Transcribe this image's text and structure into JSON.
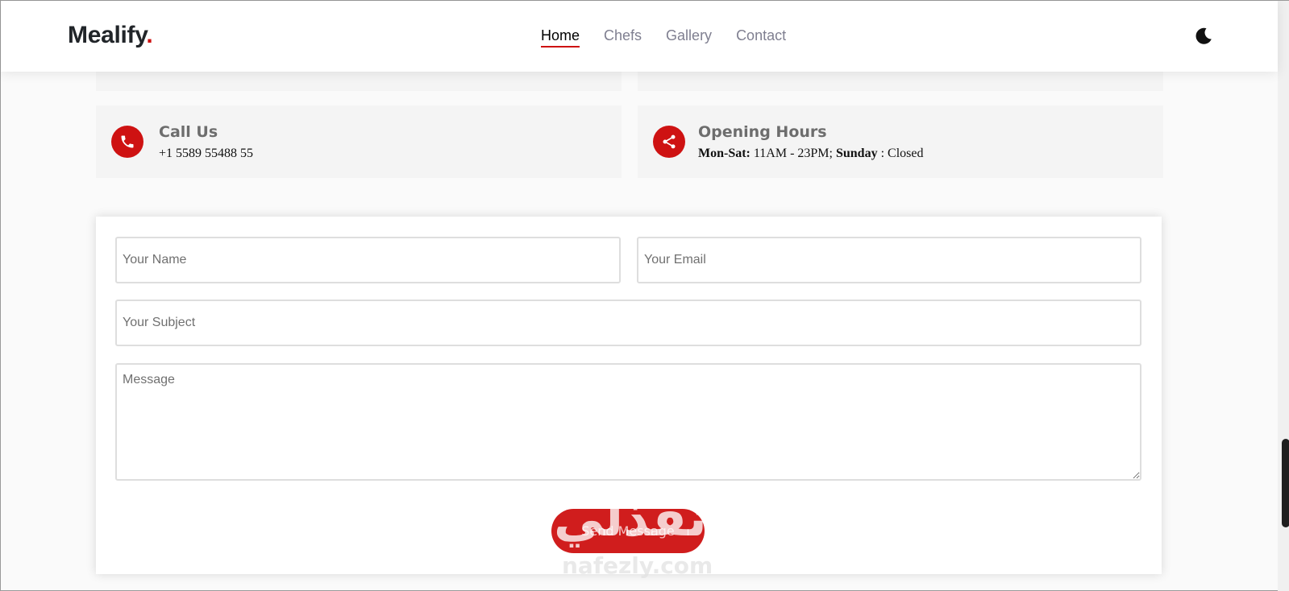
{
  "header": {
    "logo_text": "Mealify",
    "logo_dot": ".",
    "nav": [
      {
        "label": "Home",
        "active": true
      },
      {
        "label": "Chefs",
        "active": false
      },
      {
        "label": "Gallery",
        "active": false
      },
      {
        "label": "Contact",
        "active": false
      }
    ],
    "theme_toggle_icon": "moon-icon"
  },
  "contact_info": {
    "call": {
      "icon": "phone-icon",
      "title": "Call Us",
      "text": "+1 5589 55488 55"
    },
    "hours": {
      "icon": "share-icon",
      "title": "Opening Hours",
      "days_label": "Mon-Sat:",
      "days_time": " 11AM - 23PM; ",
      "sunday_label": "Sunday",
      "sunday_status": " : Closed"
    }
  },
  "form": {
    "name_placeholder": "Your Name",
    "email_placeholder": "Your Email",
    "subject_placeholder": "Your Subject",
    "message_placeholder": "Message",
    "send_label": "Send Message"
  },
  "watermark": {
    "arabic": "نفذلي",
    "latin": "nafezly.com"
  },
  "colors": {
    "accent": "#ce1212",
    "card_bg": "#f4f4f4",
    "page_bg": "#fafafa"
  }
}
